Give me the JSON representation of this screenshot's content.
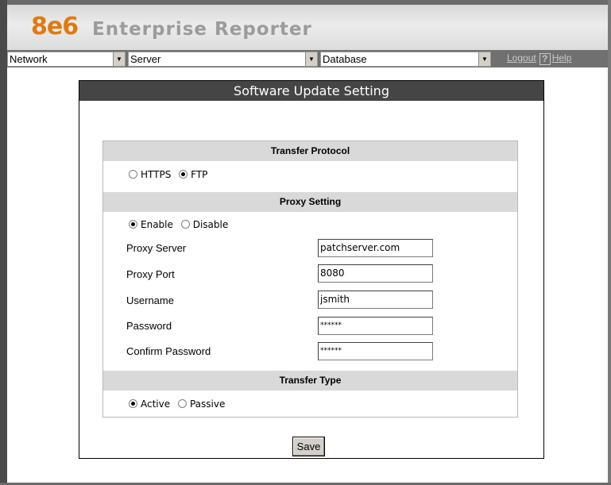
{
  "header": {
    "brand": "8e6",
    "product": "Enterprise Reporter"
  },
  "nav": {
    "selects": [
      {
        "value": "Network"
      },
      {
        "value": "Server"
      },
      {
        "value": "Database"
      }
    ],
    "logout": "Logout",
    "help_glyph": "?",
    "help": "Help"
  },
  "panel": {
    "title": "Software Update Setting",
    "transfer_protocol": {
      "heading": "Transfer Protocol",
      "options": [
        {
          "label": "HTTPS",
          "checked": false
        },
        {
          "label": "FTP",
          "checked": true
        }
      ]
    },
    "proxy": {
      "heading": "Proxy Setting",
      "options": [
        {
          "label": "Enable",
          "checked": true
        },
        {
          "label": "Disable",
          "checked": false
        }
      ],
      "fields": [
        {
          "label": "Proxy Server",
          "value": "patchserver.com"
        },
        {
          "label": "Proxy Port",
          "value": "8080"
        },
        {
          "label": "Username",
          "value": "jsmith"
        },
        {
          "label": "Password",
          "value": "******"
        },
        {
          "label": "Confirm Password",
          "value": "******"
        }
      ]
    },
    "transfer_type": {
      "heading": "Transfer Type",
      "options": [
        {
          "label": "Active",
          "checked": true
        },
        {
          "label": "Passive",
          "checked": false
        }
      ]
    },
    "save_label": "Save"
  },
  "colors": {
    "brand_orange": "#e07a10",
    "title_bar": "#454545",
    "section_bg": "#d9d9d9"
  }
}
